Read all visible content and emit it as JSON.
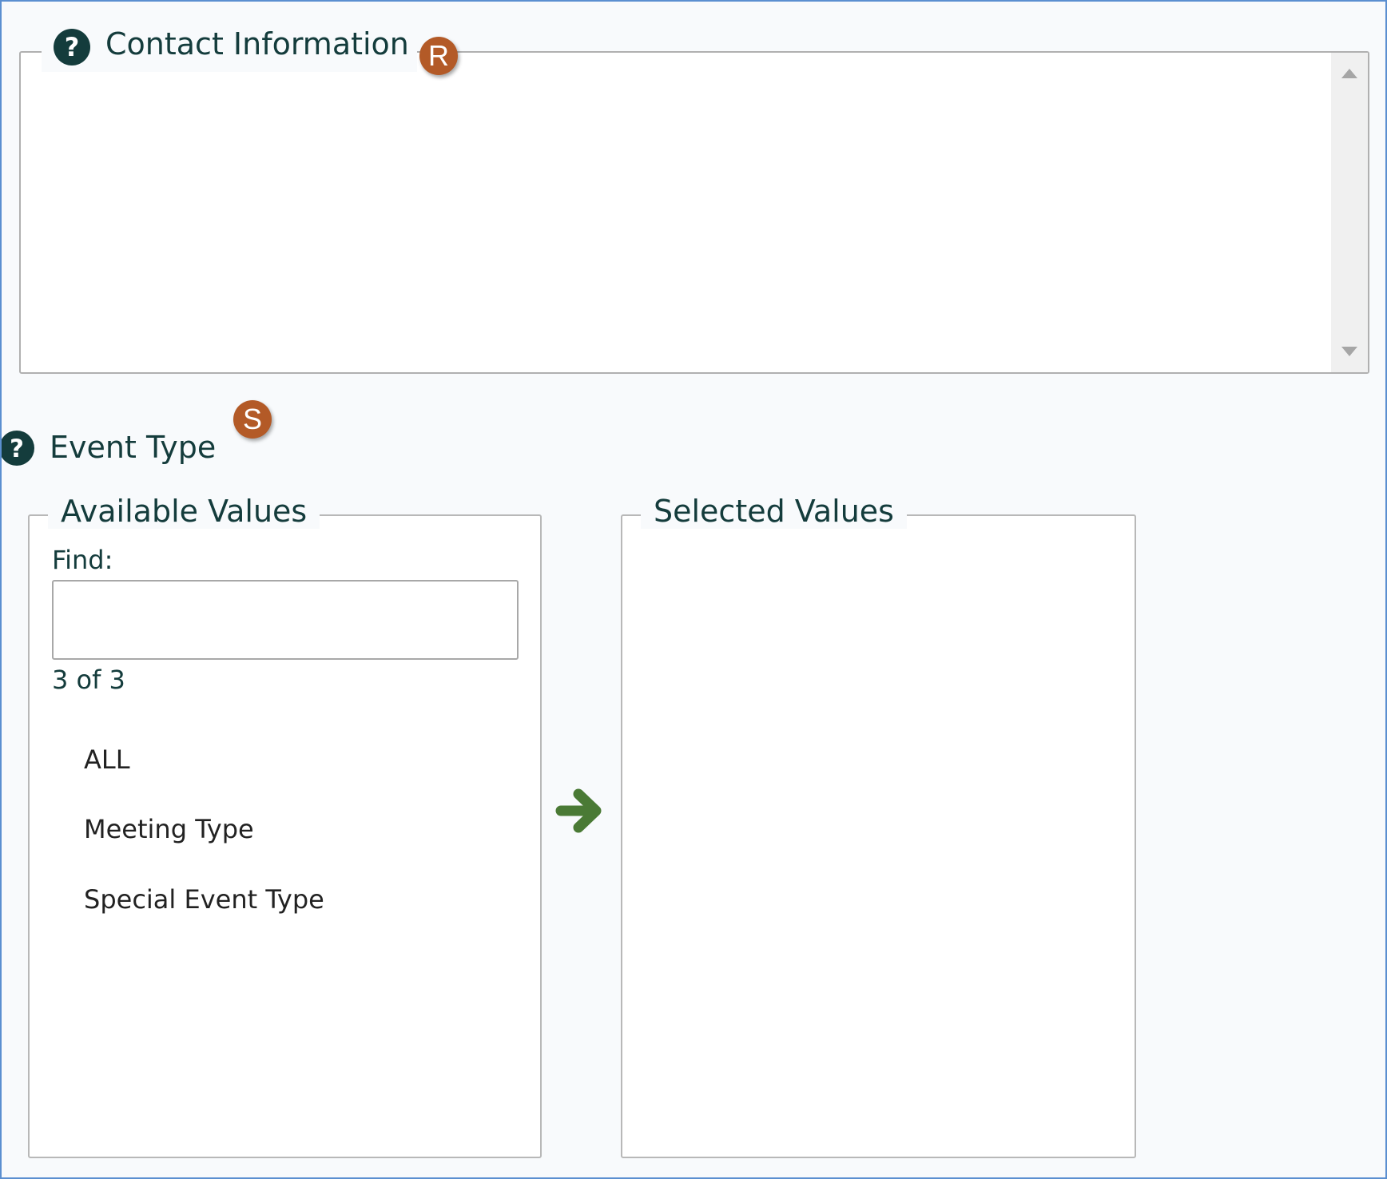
{
  "contact_information": {
    "title": "Contact Information",
    "help_icon": "question-circle-icon",
    "badge": "R",
    "value": ""
  },
  "event_type": {
    "title": "Event Type",
    "help_icon": "question-circle-icon",
    "badge": "S",
    "available": {
      "title": "Available Values",
      "find_label": "Find:",
      "find_value": "",
      "count": "3 of 3",
      "options": [
        "ALL",
        "Meeting Type",
        "Special Event Type"
      ]
    },
    "move_icon": "arrow-right-icon",
    "selected": {
      "title": "Selected Values",
      "options": []
    }
  },
  "colors": {
    "accent_dark": "#143c3c",
    "badge": "#b35a27",
    "arrow": "#4a7a35",
    "frame_border": "#5b8fd0"
  }
}
